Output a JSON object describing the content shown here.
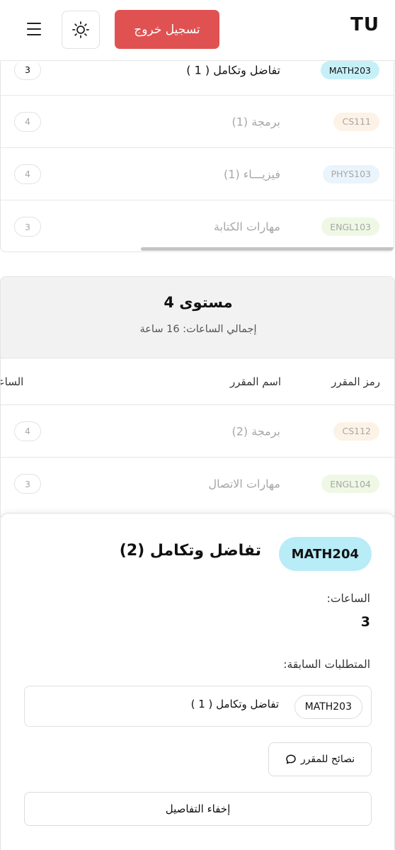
{
  "header": {
    "logo": "TU",
    "logout_label": "تسجيل خروج",
    "menu_icon": "hamburger-icon",
    "theme_icon": "sun-icon"
  },
  "level3_rows": [
    {
      "code": "MATH203",
      "name": "تفاضل وتكامل ( 1 )",
      "hours": "3",
      "badge_bg": "#c6f0f8",
      "muted": false
    },
    {
      "code": "CS111",
      "name": "برمجة (1)",
      "hours": "4",
      "badge_bg": "#fdf2e6",
      "muted": true
    },
    {
      "code": "PHYS103",
      "name": "فيزيـــاء (1)",
      "hours": "4",
      "badge_bg": "#eaf4fc",
      "muted": true
    },
    {
      "code": "ENGL103",
      "name": "مهارات الكتابة",
      "hours": "3",
      "badge_bg": "#eff8e4",
      "muted": true
    }
  ],
  "level4": {
    "title": "مستوى 4",
    "total_hours": "إجمالي الساعات: 16 ساعة",
    "columns": {
      "code": "رمز المقرر",
      "name": "اسم المقرر",
      "hours": "الساعات"
    },
    "rows": [
      {
        "code": "CS112",
        "name": "برمجة (2)",
        "hours": "4",
        "badge_bg": "#fdf2e6",
        "muted": true
      },
      {
        "code": "ENGL104",
        "name": "مهارات الاتصال",
        "hours": "3",
        "badge_bg": "#eff8e4",
        "muted": true
      }
    ]
  },
  "detail": {
    "code": "MATH204",
    "title": "تفاضل وتكامل (2)",
    "hours_label": "الساعات:",
    "hours_value": "3",
    "prereq_label": "المتطلبات السابقة:",
    "prereq_code": "MATH203",
    "prereq_name": "تفاضل وتكامل ( 1 )",
    "tips_label": "نصائح للمقرر",
    "tips_icon": "chat-bubble-icon",
    "hide_label": "إخفاء التفاصيل"
  },
  "colors": {
    "logout": "#e05252",
    "accent_badge": "#b8ecf7",
    "muted_text": "#a7a7a7"
  }
}
